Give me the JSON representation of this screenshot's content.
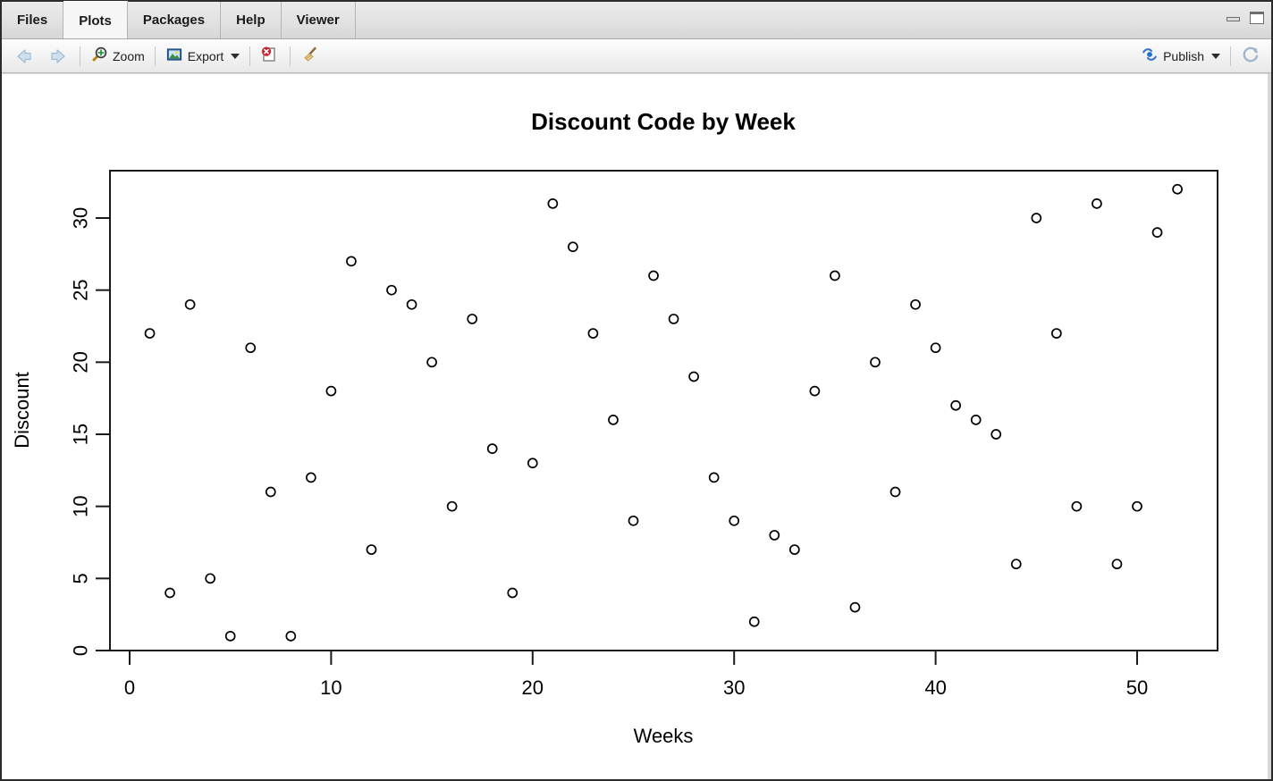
{
  "window": {
    "minimize_label": "Minimize",
    "maximize_label": "Maximize"
  },
  "tabs": [
    {
      "label": "Files",
      "active": false
    },
    {
      "label": "Plots",
      "active": true
    },
    {
      "label": "Packages",
      "active": false
    },
    {
      "label": "Help",
      "active": false
    },
    {
      "label": "Viewer",
      "active": false
    }
  ],
  "toolbar": {
    "back_label": "",
    "forward_label": "",
    "zoom_label": "Zoom",
    "export_label": "Export",
    "remove_label": "",
    "clear_all_label": "",
    "publish_label": "Publish",
    "refresh_label": "",
    "icons": {
      "back": "left-arrow-icon",
      "forward": "right-arrow-icon",
      "zoom": "magnifier-plus-icon",
      "export": "export-image-icon",
      "remove_plot": "remove-plot-icon",
      "clear_all": "broom-icon",
      "publish": "publish-icon",
      "refresh": "refresh-icon"
    }
  },
  "chart_data": {
    "type": "scatter",
    "title": "Discount Code by Week",
    "xlabel": "Weeks",
    "ylabel": "Discount",
    "xlim": [
      0,
      53
    ],
    "ylim": [
      0,
      33
    ],
    "xticks": [
      0,
      10,
      20,
      30,
      40,
      50
    ],
    "yticks": [
      0,
      5,
      10,
      15,
      20,
      25,
      30
    ],
    "grid": false,
    "legend": null,
    "marker": "open-circle",
    "marker_color": "#000000",
    "x": [
      1,
      2,
      3,
      4,
      5,
      6,
      7,
      8,
      9,
      10,
      11,
      12,
      13,
      14,
      15,
      16,
      17,
      18,
      19,
      20,
      21,
      22,
      23,
      24,
      25,
      26,
      27,
      28,
      29,
      30,
      31,
      32,
      33,
      34,
      35,
      36,
      37,
      38,
      39,
      40,
      41,
      42,
      43,
      44,
      45,
      46,
      47,
      48,
      49,
      50,
      51,
      52
    ],
    "y": [
      22,
      4,
      24,
      5,
      1,
      21,
      11,
      1,
      12,
      18,
      27,
      7,
      25,
      24,
      20,
      10,
      23,
      14,
      4,
      13,
      31,
      28,
      22,
      16,
      9,
      26,
      23,
      19,
      12,
      9,
      2,
      8,
      7,
      18,
      26,
      3,
      20,
      11,
      24,
      21,
      17,
      16,
      15,
      6,
      30,
      22,
      10,
      31,
      6,
      10,
      29,
      32
    ]
  }
}
